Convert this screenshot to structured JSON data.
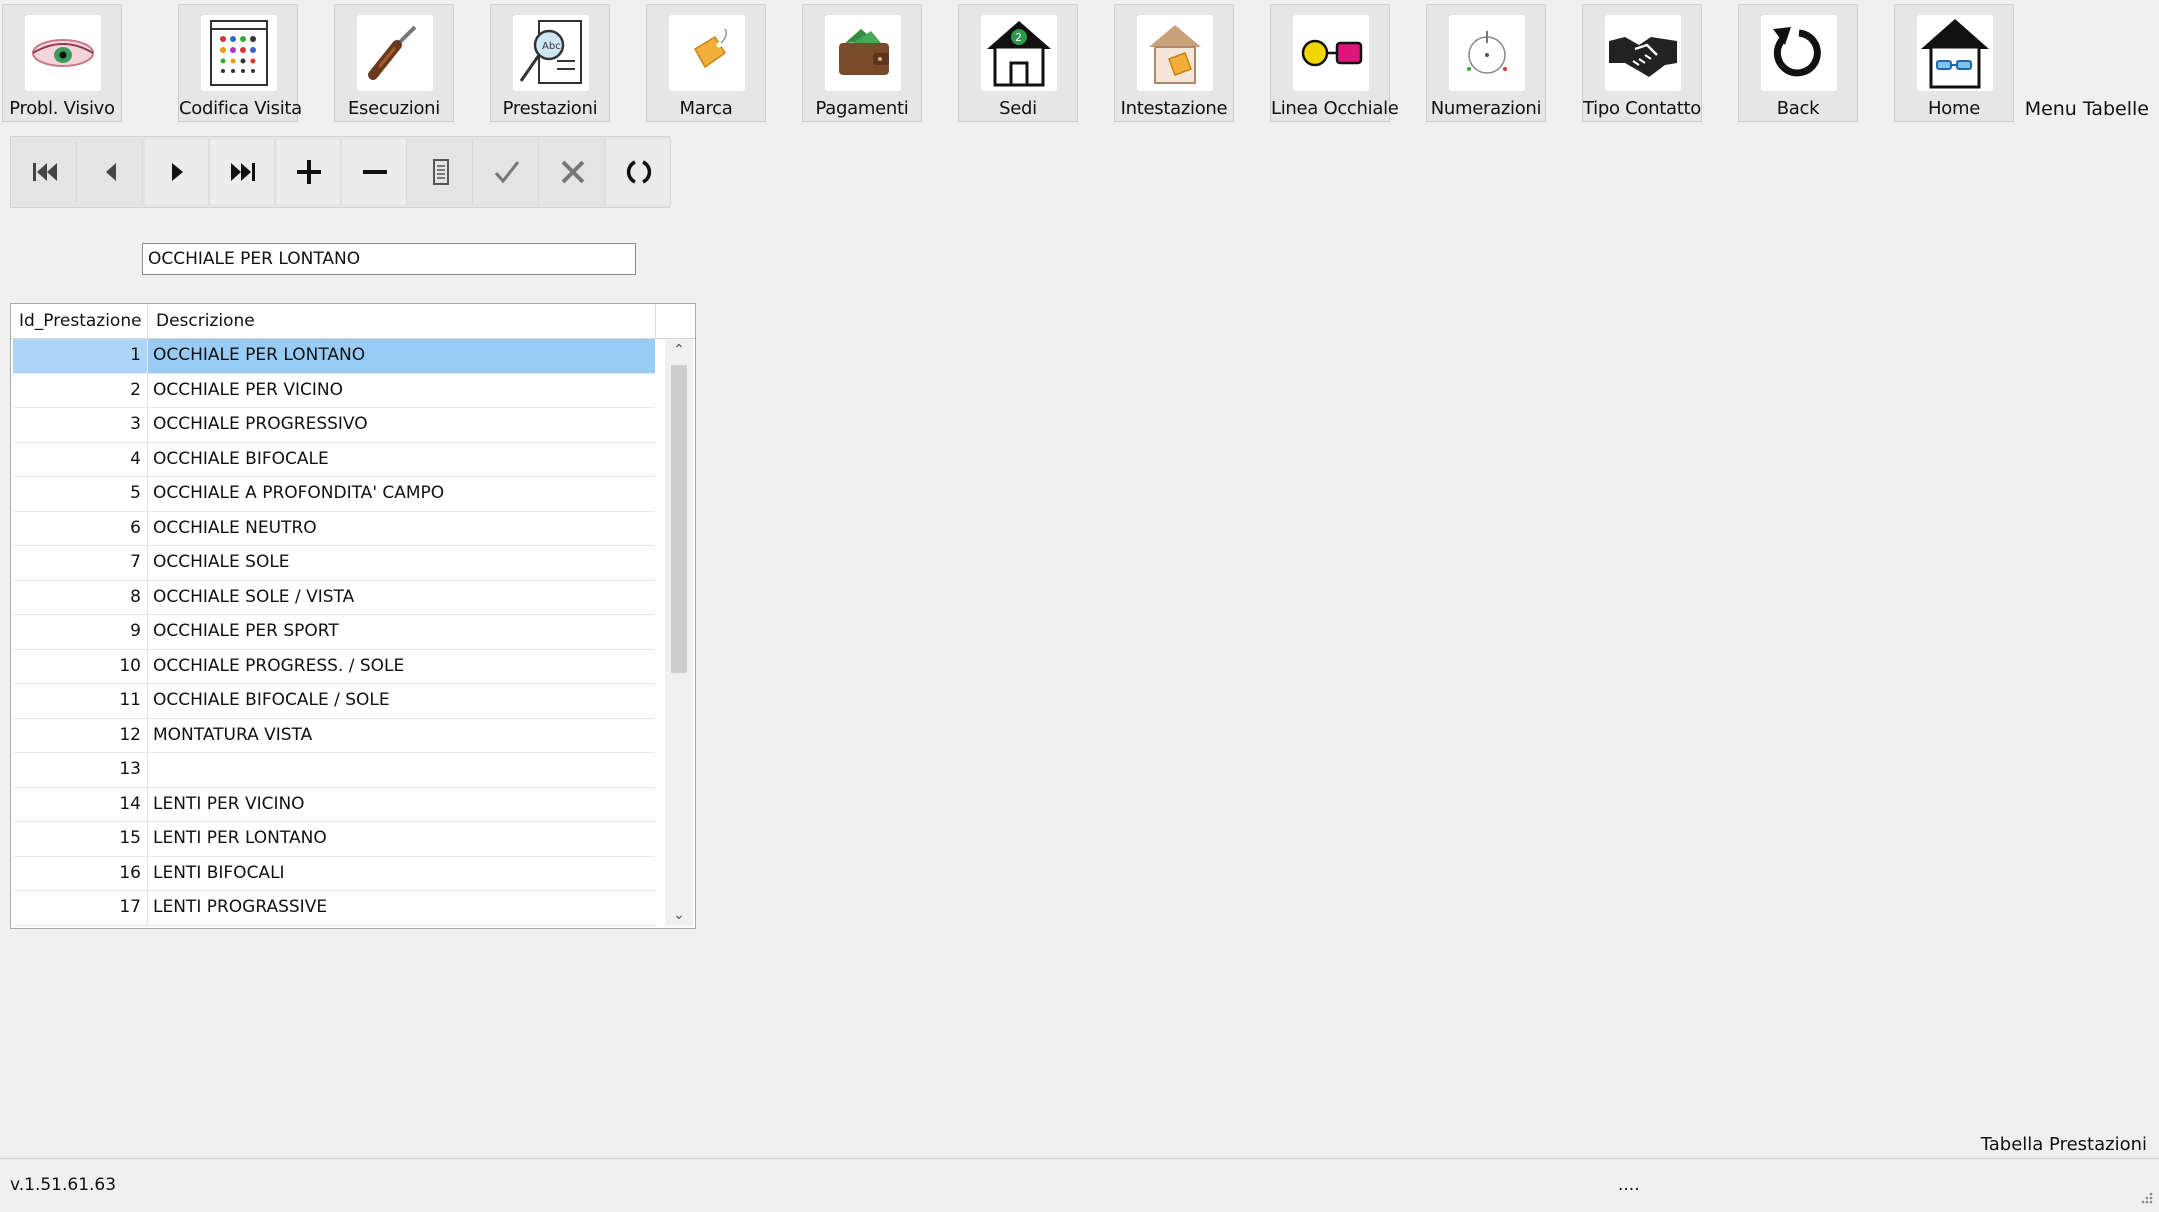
{
  "toolbar": {
    "buttons": [
      {
        "label": "Probl. Visivo",
        "icon": "eye-icon"
      },
      {
        "label": "Codifica Visita",
        "icon": "color-chart-icon"
      },
      {
        "label": "Esecuzioni",
        "icon": "screwdriver-icon"
      },
      {
        "label": "Prestazioni",
        "icon": "magnifier-document-icon"
      },
      {
        "label": "Marca",
        "icon": "price-tag-icon"
      },
      {
        "label": "Pagamenti",
        "icon": "wallet-icon"
      },
      {
        "label": "Sedi",
        "icon": "house-number-icon"
      },
      {
        "label": "Intestazione",
        "icon": "house-tag-icon"
      },
      {
        "label": "Linea Occhiale",
        "icon": "glasses-shapes-icon"
      },
      {
        "label": "Numerazioni",
        "icon": "dial-icon"
      },
      {
        "label": "Tipo Contatto",
        "icon": "handshake-icon"
      },
      {
        "label": "Back",
        "icon": "back-arrow-icon"
      },
      {
        "label": "Home",
        "icon": "home-icon"
      }
    ],
    "menu_label": "Menu Tabelle"
  },
  "navigator": {
    "buttons": [
      "first-icon",
      "previous-icon",
      "next-icon",
      "last-icon",
      "add-icon",
      "delete-icon",
      "edit-icon",
      "post-icon",
      "cancel-icon",
      "refresh-icon"
    ]
  },
  "filter": {
    "value": "OCCHIALE PER LONTANO"
  },
  "grid": {
    "columns": [
      "Id_Prestazione",
      "Descrizione"
    ],
    "selected_row": 0,
    "rows": [
      {
        "id": "1",
        "desc": "OCCHIALE PER LONTANO"
      },
      {
        "id": "2",
        "desc": "OCCHIALE PER VICINO"
      },
      {
        "id": "3",
        "desc": "OCCHIALE PROGRESSIVO"
      },
      {
        "id": "4",
        "desc": "OCCHIALE BIFOCALE"
      },
      {
        "id": "5",
        "desc": "OCCHIALE A PROFONDITA' CAMPO"
      },
      {
        "id": "6",
        "desc": "OCCHIALE NEUTRO"
      },
      {
        "id": "7",
        "desc": "OCCHIALE SOLE"
      },
      {
        "id": "8",
        "desc": "OCCHIALE SOLE / VISTA"
      },
      {
        "id": "9",
        "desc": "OCCHIALE PER SPORT"
      },
      {
        "id": "10",
        "desc": "OCCHIALE PROGRESS. / SOLE"
      },
      {
        "id": "11",
        "desc": "OCCHIALE BIFOCALE / SOLE"
      },
      {
        "id": "12",
        "desc": "MONTATURA VISTA"
      },
      {
        "id": "13",
        "desc": ""
      },
      {
        "id": "14",
        "desc": "LENTI PER VICINO"
      },
      {
        "id": "15",
        "desc": "LENTI PER LONTANO"
      },
      {
        "id": "16",
        "desc": "LENTI BIFOCALI"
      },
      {
        "id": "17",
        "desc": "LENTI PROGRASSIVE"
      }
    ]
  },
  "footer": {
    "title": "Tabella Prestazioni",
    "version": "v.1.51.61.63",
    "status": "...."
  },
  "colors": {
    "selection": "#99ccf5",
    "background": "#f0f0f0"
  }
}
